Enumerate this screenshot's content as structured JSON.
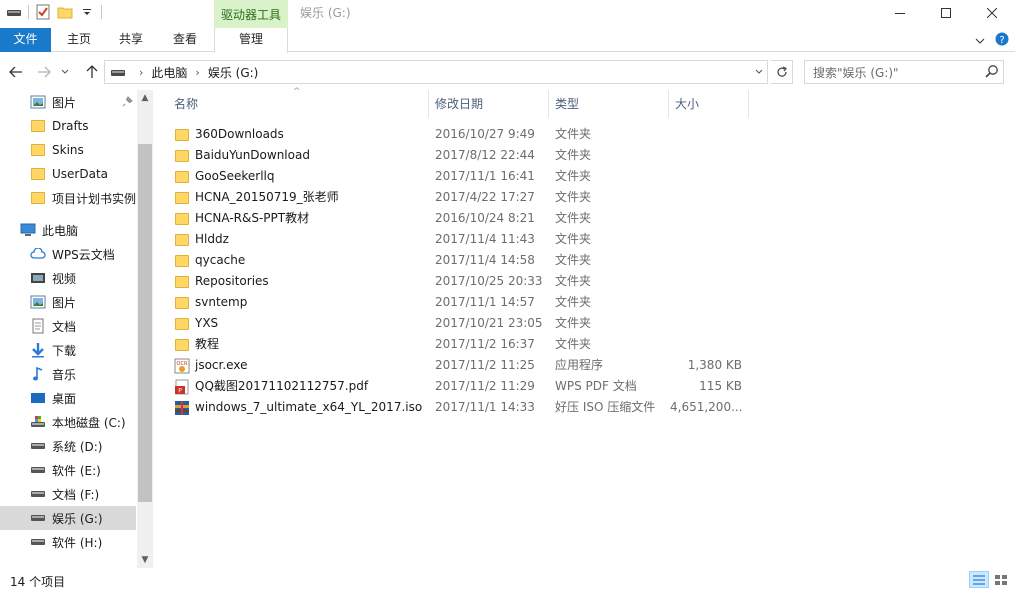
{
  "window": {
    "title": "娱乐 (G:)",
    "context_tab_header": "驱动器工具"
  },
  "ribbon": {
    "tabs": [
      "文件",
      "主页",
      "共享",
      "查看",
      "管理"
    ]
  },
  "address": {
    "crumbs": [
      "此电脑",
      "娱乐 (G:)"
    ]
  },
  "search": {
    "placeholder": "搜索\"娱乐 (G:)\""
  },
  "nav": {
    "items": [
      {
        "label": "图片",
        "icon": "pictures-icon",
        "pinned": true
      },
      {
        "label": "Drafts",
        "icon": "folder-icon"
      },
      {
        "label": "Skins",
        "icon": "folder-icon"
      },
      {
        "label": "UserData",
        "icon": "folder-icon"
      },
      {
        "label": "项目计划书实例",
        "icon": "folder-icon"
      },
      {
        "label": "此电脑",
        "icon": "this-pc-icon"
      },
      {
        "label": "WPS云文档",
        "icon": "cloud-icon"
      },
      {
        "label": "视频",
        "icon": "videos-icon"
      },
      {
        "label": "图片",
        "icon": "pictures-icon"
      },
      {
        "label": "文档",
        "icon": "documents-icon"
      },
      {
        "label": "下载",
        "icon": "downloads-icon"
      },
      {
        "label": "音乐",
        "icon": "music-icon"
      },
      {
        "label": "桌面",
        "icon": "desktop-icon"
      },
      {
        "label": "本地磁盘 (C:)",
        "icon": "system-drive-icon"
      },
      {
        "label": "系统 (D:)",
        "icon": "drive-icon"
      },
      {
        "label": "软件 (E:)",
        "icon": "drive-icon"
      },
      {
        "label": "文档 (F:)",
        "icon": "drive-icon"
      },
      {
        "label": "娱乐 (G:)",
        "icon": "drive-icon",
        "selected": true
      },
      {
        "label": "软件 (H:)",
        "icon": "drive-icon"
      }
    ]
  },
  "columns": {
    "name": "名称",
    "date": "修改日期",
    "type": "类型",
    "size": "大小"
  },
  "files": [
    {
      "name": "360Downloads",
      "date": "2016/10/27 9:49",
      "type": "文件夹",
      "size": "",
      "icon": "folder-icon"
    },
    {
      "name": "BaiduYunDownload",
      "date": "2017/8/12 22:44",
      "type": "文件夹",
      "size": "",
      "icon": "folder-icon"
    },
    {
      "name": "GooSeekerllq",
      "date": "2017/11/1 16:41",
      "type": "文件夹",
      "size": "",
      "icon": "folder-icon"
    },
    {
      "name": "HCNA_20150719_张老师",
      "date": "2017/4/22 17:27",
      "type": "文件夹",
      "size": "",
      "icon": "folder-icon"
    },
    {
      "name": "HCNA-R&S-PPT教材",
      "date": "2016/10/24 8:21",
      "type": "文件夹",
      "size": "",
      "icon": "folder-icon"
    },
    {
      "name": "Hlddz",
      "date": "2017/11/4 11:43",
      "type": "文件夹",
      "size": "",
      "icon": "folder-icon"
    },
    {
      "name": "qycache",
      "date": "2017/11/4 14:58",
      "type": "文件夹",
      "size": "",
      "icon": "folder-icon"
    },
    {
      "name": "Repositories",
      "date": "2017/10/25 20:33",
      "type": "文件夹",
      "size": "",
      "icon": "folder-icon"
    },
    {
      "name": "svntemp",
      "date": "2017/11/1 14:57",
      "type": "文件夹",
      "size": "",
      "icon": "folder-icon"
    },
    {
      "name": "YXS",
      "date": "2017/10/21 23:05",
      "type": "文件夹",
      "size": "",
      "icon": "folder-icon"
    },
    {
      "name": "教程",
      "date": "2017/11/2 16:37",
      "type": "文件夹",
      "size": "",
      "icon": "folder-icon"
    },
    {
      "name": "jsocr.exe",
      "date": "2017/11/2 11:25",
      "type": "应用程序",
      "size": "1,380 KB",
      "icon": "ocr-app-icon"
    },
    {
      "name": "QQ截图20171102112757.pdf",
      "date": "2017/11/2 11:29",
      "type": "WPS PDF 文档",
      "size": "115 KB",
      "icon": "pdf-icon"
    },
    {
      "name": "windows_7_ultimate_x64_YL_2017.iso",
      "date": "2017/11/1 14:33",
      "type": "好压 ISO 压缩文件",
      "size": "4,651,200...",
      "icon": "iso-archive-icon"
    }
  ],
  "status": {
    "item_count": "14 个项目"
  }
}
